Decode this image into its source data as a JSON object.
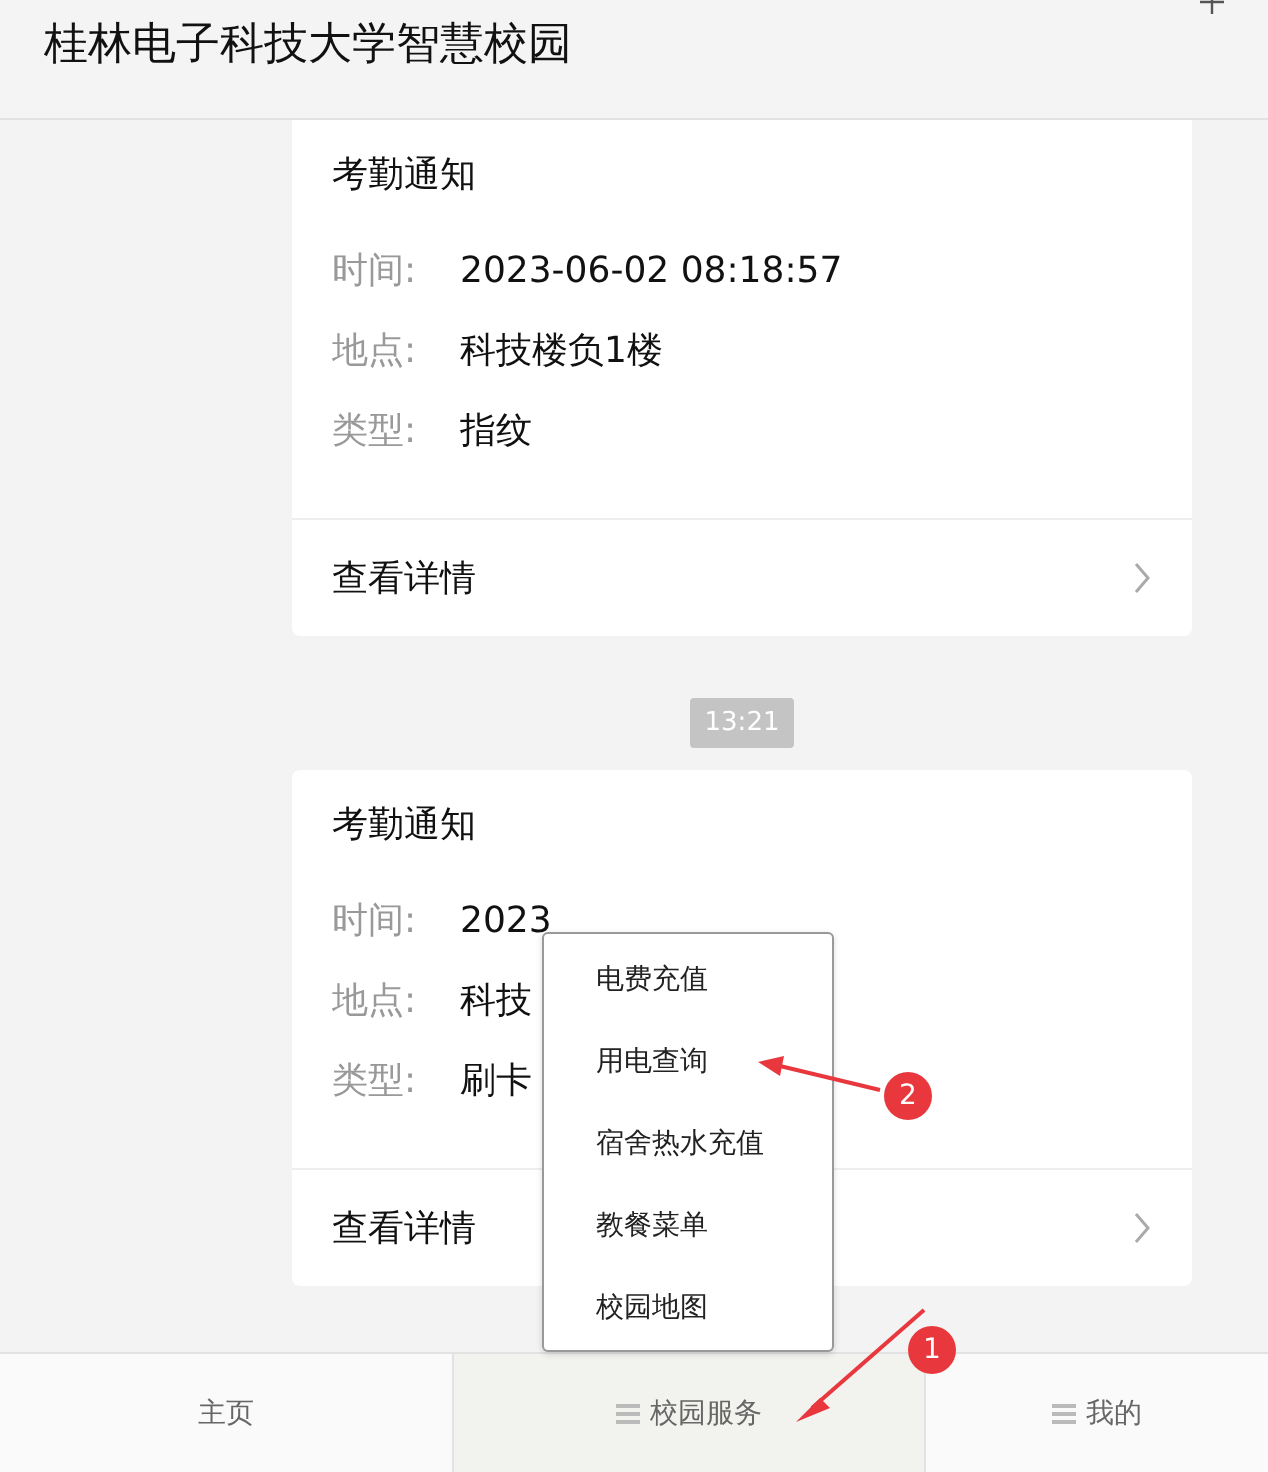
{
  "header": {
    "title": "桂林电子科技大学智慧校园"
  },
  "messages": [
    {
      "kind": "card",
      "title": "考勤通知",
      "fields": [
        {
          "label": "时间:",
          "value": "2023-06-02 08:18:57"
        },
        {
          "label": "地点:",
          "value": "科技楼负1楼"
        },
        {
          "label": "类型:",
          "value": "指纹"
        }
      ],
      "link": "查看详情"
    },
    {
      "kind": "time",
      "text": "13:21"
    },
    {
      "kind": "card",
      "title": "考勤通知",
      "fields": [
        {
          "label": "时间:",
          "value": "2023"
        },
        {
          "label": "地点:",
          "value": "科技"
        },
        {
          "label": "类型:",
          "value": "刷卡"
        }
      ],
      "link": "查看详情"
    }
  ],
  "popup_menu": {
    "items": [
      "电费充值",
      "用电查询",
      "宿舍热水充值",
      "教餐菜单",
      "校园地图"
    ]
  },
  "tabs": [
    {
      "label": "主页",
      "icon": false,
      "selected": false
    },
    {
      "label": "校园服务",
      "icon": true,
      "selected": true
    },
    {
      "label": "我的",
      "icon": true,
      "selected": false
    }
  ],
  "annotations": [
    {
      "label": "1"
    },
    {
      "label": "2"
    }
  ]
}
